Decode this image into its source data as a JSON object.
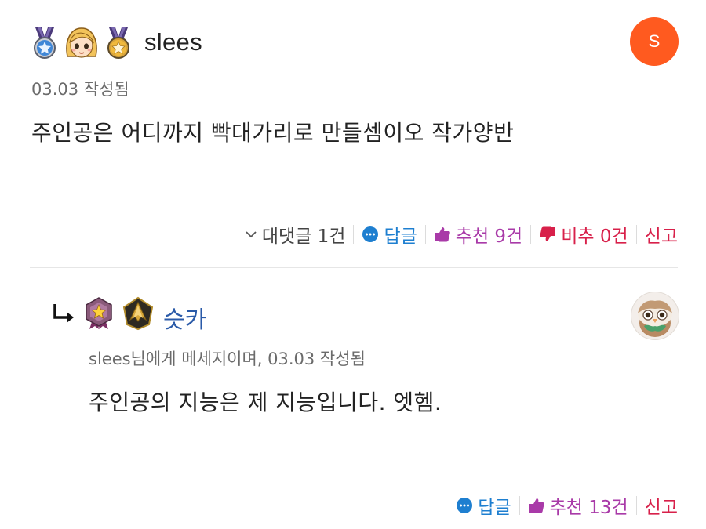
{
  "comments": [
    {
      "author": "slees",
      "avatar_letter": "S",
      "badges": [
        "blue-star-medal-icon",
        "blonde-girl-avatar-icon",
        "gold-star-medal-icon"
      ],
      "meta": "03.03 작성됨",
      "text": "주인공은 어디까지 빡대가리로 만들셈이오 작가양반",
      "actions": {
        "replies_toggle": "대댓글 1건",
        "reply": "답글",
        "recommend": "추천 9건",
        "unrecommend": "비추 0건",
        "report": "신고"
      }
    },
    {
      "author": "슷카",
      "badges": [
        "purple-star-emblem-icon",
        "gold-dark-emblem-icon"
      ],
      "meta": "slees님에게 메세지이며, 03.03 작성됨",
      "text": "주인공의 지능은 제 지능입니다. 엣헴.",
      "actions": {
        "reply": "답글",
        "recommend": "추천 13건",
        "report": "신고"
      }
    }
  ],
  "colors": {
    "blue": "#1e7fd0",
    "purple": "#a93aa8",
    "red": "#d8204a",
    "avatar_orange": "#ff5a1f",
    "reply_author": "#2a5aa8"
  }
}
